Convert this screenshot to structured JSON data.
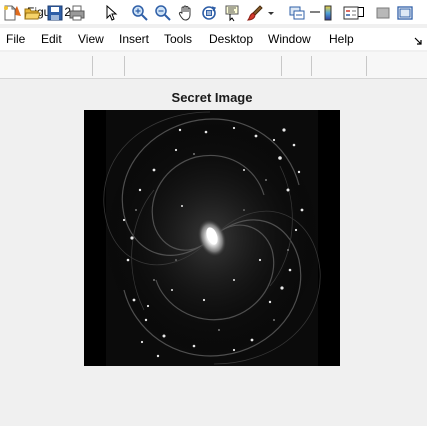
{
  "window": {
    "title": "Figure 2",
    "app_icon": "matlab-icon"
  },
  "menu": {
    "items": [
      "File",
      "Edit",
      "View",
      "Insert",
      "Tools",
      "Desktop",
      "Window",
      "Help"
    ]
  },
  "toolbar": {
    "buttons": [
      "new-figure-icon",
      "open-file-icon",
      "save-icon",
      "print-icon",
      "edit-plot-arrow-icon",
      "zoom-in-icon",
      "zoom-out-icon",
      "pan-hand-icon",
      "rotate-3d-icon",
      "data-cursor-icon",
      "brush-icon",
      "link-plot-icon",
      "colorbar-icon",
      "legend-icon",
      "hide-plot-tools-icon",
      "show-plot-tools-icon"
    ]
  },
  "axes": {
    "title": "Secret Image"
  },
  "colors": {
    "figure_background": "#f0f0f0",
    "title_bar": "#ffffff",
    "menu_bar": "#ffffff",
    "toolbar": "#f7f7f7",
    "image_background": "#000000"
  }
}
